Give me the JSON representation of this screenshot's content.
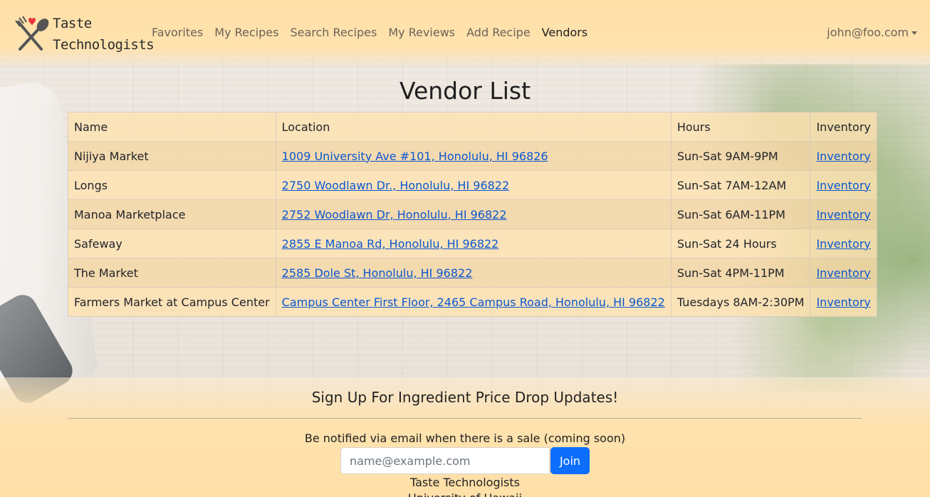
{
  "brand": {
    "line1": "Taste",
    "line2": "Technologists"
  },
  "nav": {
    "links": [
      {
        "label": "Favorites"
      },
      {
        "label": "My Recipes"
      },
      {
        "label": "Search Recipes"
      },
      {
        "label": "My Reviews"
      },
      {
        "label": "Add Recipe"
      },
      {
        "label": "Vendors"
      }
    ],
    "active": "Vendors",
    "user": "john@foo.com"
  },
  "page": {
    "title": "Vendor List"
  },
  "table": {
    "headers": {
      "name": "Name",
      "location": "Location",
      "hours": "Hours",
      "inventory": "Inventory"
    },
    "rows": [
      {
        "name": "Nijiya Market",
        "location": "1009 University Ave #101, Honolulu, HI 96826",
        "hours": "Sun-Sat 9AM-9PM",
        "inventory": "Inventory"
      },
      {
        "name": "Longs",
        "location": "2750 Woodlawn Dr., Honolulu, HI 96822",
        "hours": "Sun-Sat 7AM-12AM",
        "inventory": "Inventory"
      },
      {
        "name": "Manoa Marketplace",
        "location": "2752 Woodlawn Dr, Honolulu, HI 96822",
        "hours": "Sun-Sat 6AM-11PM",
        "inventory": "Inventory"
      },
      {
        "name": "Safeway",
        "location": "2855 E Manoa Rd, Honolulu, HI 96822",
        "hours": "Sun-Sat 24 Hours",
        "inventory": "Inventory"
      },
      {
        "name": "The Market",
        "location": "2585 Dole St, Honolulu, HI 96822",
        "hours": "Sun-Sat 4PM-11PM",
        "inventory": "Inventory"
      },
      {
        "name": "Farmers Market at Campus Center",
        "location": "Campus Center First Floor, 2465 Campus Road, Honolulu, HI 96822",
        "hours": "Tuesdays 8AM-2:30PM",
        "inventory": "Inventory"
      }
    ]
  },
  "footer": {
    "title": "Sign Up For Ingredient Price Drop Updates!",
    "description": "Be notified via email when there is a sale (coming soon)",
    "email_placeholder": "name@example.com",
    "join_label": "Join",
    "brand": "Taste Technologists",
    "sub": "University of Hawaii"
  },
  "colors": {
    "navbar": "#ffe0a8",
    "link": "#0b57d0",
    "button": "#0d6efd",
    "heart": "#e8333a"
  },
  "icons": {
    "logo": "fork-spoon-heart-icon",
    "user_caret": "caret-down-icon"
  }
}
